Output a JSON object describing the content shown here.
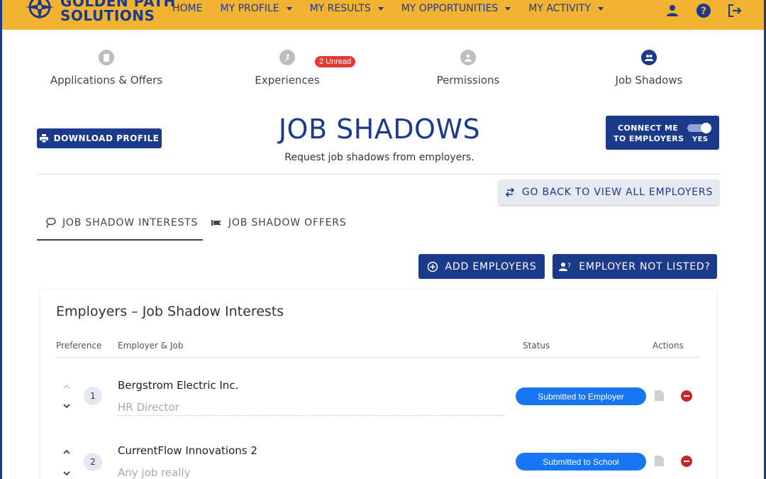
{
  "brand": {
    "line1": "GOLDEN PATH",
    "line2": "SOLUTIONS"
  },
  "nav": {
    "home": "HOME",
    "profile": "MY PROFILE",
    "results": "MY RESULTS",
    "opportunities": "MY OPPORTUNITIES",
    "activity": "MY ACTIVITY"
  },
  "top_icons": [
    "user-icon",
    "help-icon",
    "logout-icon"
  ],
  "subnav": {
    "applications": "Applications & Offers",
    "experiences": "Experiences",
    "experiences_badge": "2 Unread",
    "permissions": "Permissions",
    "job_shadows": "Job Shadows"
  },
  "header": {
    "download": "DOWNLOAD PROFILE",
    "title": "JOB SHADOWS",
    "subtitle": "Request job shadows from employers.",
    "connect_line1": "CONNECT ME",
    "connect_line2": "TO EMPLOYERS",
    "connect_state": "YES"
  },
  "back_button": "GO BACK TO VIEW ALL EMPLOYERS",
  "tabs": {
    "interests": "JOB SHADOW INTERESTS",
    "offers": "JOB SHADOW OFFERS"
  },
  "actions": {
    "add": "ADD EMPLOYERS",
    "not_listed": "EMPLOYER NOT LISTED?"
  },
  "table": {
    "title": "Employers – Job Shadow Interests",
    "headers": {
      "preference": "Preference",
      "employer": "Employer & Job",
      "status": "Status",
      "actions": "Actions"
    },
    "rows": [
      {
        "rank": "1",
        "employer": "Bergstrom Electric Inc.",
        "job": "HR Director",
        "status": "Submitted to Employer"
      },
      {
        "rank": "2",
        "employer": "CurrentFlow Innovations 2",
        "job": "Any job really",
        "status": "Submitted to School"
      }
    ]
  },
  "colors": {
    "navy": "#1c3a8a",
    "gold": "#f2b232",
    "status_blue": "#1976f2",
    "remove_red": "#c62828",
    "badge_red": "#e53935"
  }
}
